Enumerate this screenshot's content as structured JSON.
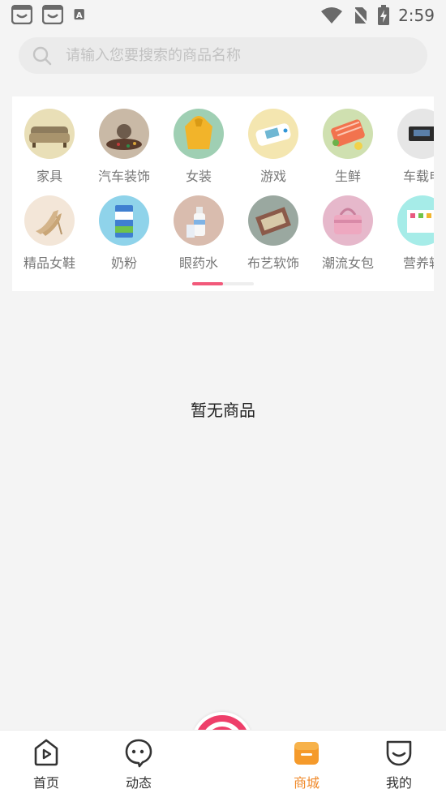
{
  "status_bar": {
    "time": "2:59",
    "left_icons": [
      "app-notification-icon",
      "app-notification-icon",
      "font-a-icon"
    ],
    "right_icons": [
      "wifi-icon",
      "no-sim-icon",
      "battery-charging-icon"
    ]
  },
  "search": {
    "placeholder": "请输入您要搜索的商品名称"
  },
  "categories": [
    {
      "label": "家具",
      "icon": "sofa-image",
      "bg": "#e9dfb7"
    },
    {
      "label": "汽车装饰",
      "icon": "car-ornament-image",
      "bg": "#c9b9a6"
    },
    {
      "label": "女装",
      "icon": "yellow-raincoat-image",
      "bg": "#9fcfb3"
    },
    {
      "label": "游戏",
      "icon": "game-console-image",
      "bg": "#f4e6b0"
    },
    {
      "label": "生鲜",
      "icon": "salmon-image",
      "bg": "#cfe0b0"
    },
    {
      "label": "车载电",
      "icon": "car-electronics-image",
      "bg": "#e6e6e6"
    },
    {
      "label": "精品女鞋",
      "icon": "high-heel-image",
      "bg": "#f3e6d8"
    },
    {
      "label": "奶粉",
      "icon": "milk-powder-image",
      "bg": "#8fd3ea"
    },
    {
      "label": "眼药水",
      "icon": "eye-drops-image",
      "bg": "#d9bcae"
    },
    {
      "label": "布艺软饰",
      "icon": "rug-image",
      "bg": "#9aa8a0"
    },
    {
      "label": "潮流女包",
      "icon": "handbag-image",
      "bg": "#e6b8cb"
    },
    {
      "label": "营养辅",
      "icon": "nutrition-box-image",
      "bg": "#a6ece8"
    }
  ],
  "empty_text": "暂无商品",
  "bottom_nav": {
    "items": [
      {
        "label": "首页",
        "icon": "home-play-icon"
      },
      {
        "label": "动态",
        "icon": "chat-bubble-icon"
      },
      {
        "label": "商城",
        "icon": "shop-bag-icon",
        "active": true
      },
      {
        "label": "我的",
        "icon": "smile-cup-icon"
      }
    ],
    "center_icon": "camera-record-icon"
  },
  "colors": {
    "accent_pink": "#f2597a",
    "active_orange": "#f08a2b",
    "page_bg": "#f4f4f4"
  }
}
